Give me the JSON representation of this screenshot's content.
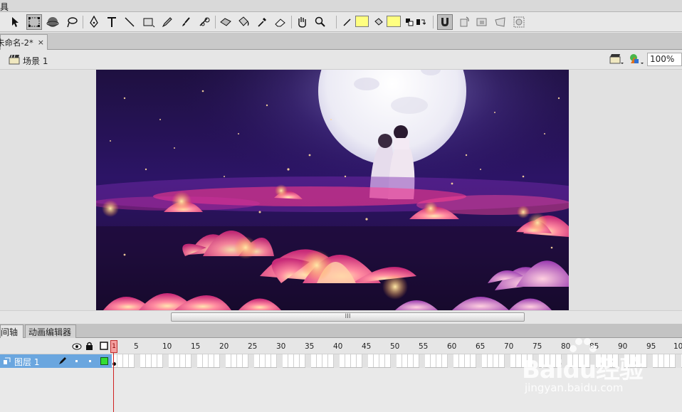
{
  "menubar": {
    "label": "具"
  },
  "document_tab": {
    "title": "未命名-2*",
    "close": "×"
  },
  "scene": {
    "label": "场景 1",
    "zoom": "100%"
  },
  "scrollbar": {
    "grip": "III"
  },
  "timeline": {
    "tabs": [
      "间轴",
      "动画编辑器"
    ],
    "layer": {
      "name": "图层 1"
    },
    "frame_numbers": [
      "1",
      "5",
      "10",
      "15",
      "20",
      "25",
      "30",
      "35",
      "40",
      "45",
      "50",
      "55",
      "60",
      "65",
      "70",
      "75",
      "80",
      "85",
      "90",
      "95",
      "10"
    ]
  },
  "colors": {
    "stroke": "#ffff80",
    "fill": "#ffff80",
    "layer_highlight": "#6aa6df",
    "layer_color_box": "#33dd33"
  },
  "watermark": {
    "logo": "Baidu经验",
    "url": "jingyan.baidu.com"
  }
}
